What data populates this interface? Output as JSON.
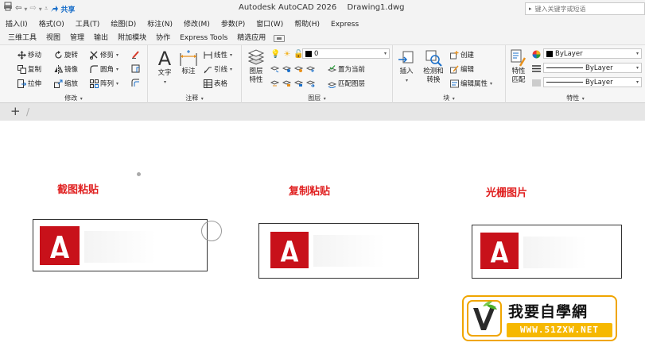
{
  "titlebar": {
    "share_label": "共享",
    "app_name": "Autodesk AutoCAD 2026",
    "document": "Drawing1.dwg",
    "search_placeholder": "键入关键字或短语"
  },
  "menu": [
    "插入(I)",
    "格式(O)",
    "工具(T)",
    "绘图(D)",
    "标注(N)",
    "修改(M)",
    "参数(P)",
    "窗口(W)",
    "帮助(H)",
    "Express"
  ],
  "ribbon_tabs": [
    "三维工具",
    "视图",
    "管理",
    "输出",
    "附加模块",
    "协作",
    "Express Tools",
    "精选应用"
  ],
  "modify_panel": {
    "label": "修改",
    "tools": [
      "移动",
      "旋转",
      "修剪",
      "复制",
      "镜像",
      "圆角",
      "拉伸",
      "缩放",
      "阵列"
    ]
  },
  "annotation_panel": {
    "label": "注释",
    "text_label": "文字",
    "dim_label": "标注",
    "linear_label": "线性",
    "leader_label": "引线",
    "table_label": "表格"
  },
  "layers_panel": {
    "label": "图层",
    "props_label": "图层\n特性",
    "layer_value": "0",
    "set_current_label": "置为当前",
    "match_layer_label": "匹配图层"
  },
  "block_panel": {
    "label": "块",
    "insert_label": "插入",
    "detect_label": "检测和\n转换",
    "create_label": "创建",
    "edit_label": "编辑",
    "edit_attr_label": "编辑属性"
  },
  "properties_panel": {
    "label": "特性",
    "match_label": "特性\n匹配",
    "color_value": "ByLayer",
    "linetype_value": "ByLayer",
    "lineweight_value": "ByLayer"
  },
  "canvas": {
    "caption_1": "截图粘贴",
    "caption_2": "复制粘贴",
    "caption_3": "光栅图片",
    "logo_letter": "A"
  },
  "watermark": {
    "title": "我要自學網",
    "url": "WWW.51ZXW.NET"
  },
  "colors": {
    "autocad_red": "#c8111a",
    "caption_red": "#e02020",
    "watermark_orange": "#f6b800",
    "share_blue": "#1a6fc9"
  }
}
